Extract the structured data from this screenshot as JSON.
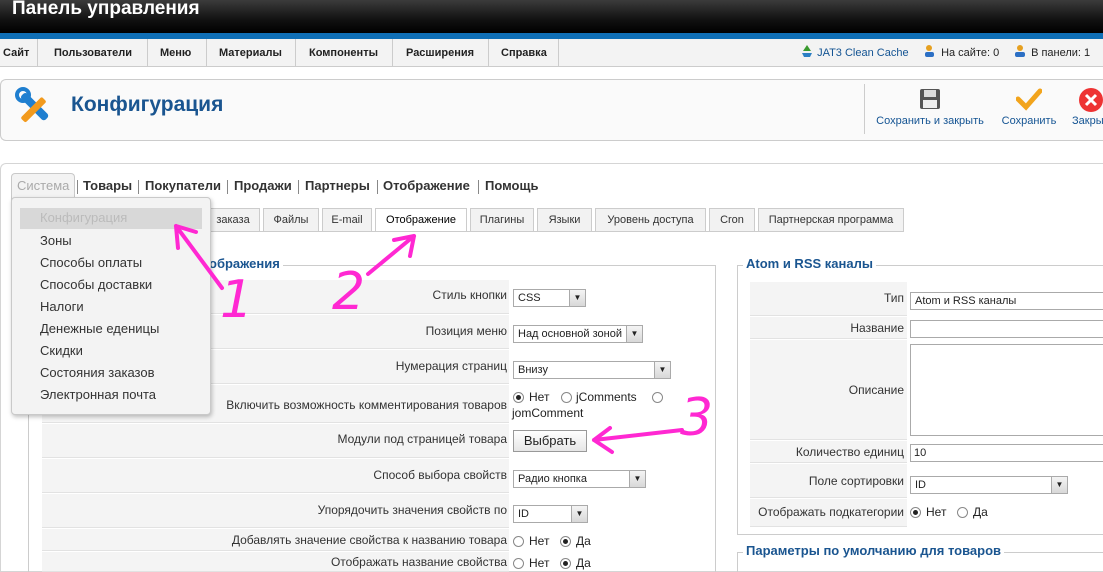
{
  "app_title": "Панель управления",
  "menubar": {
    "items": [
      "Сайт",
      "Пользователи",
      "Меню",
      "Материалы",
      "Компоненты",
      "Расширения",
      "Справка"
    ],
    "cache_label": "JAT3 Clean Cache",
    "online_label": "На сайте: 0",
    "admin_label": "В панели: 1"
  },
  "header": {
    "title": "Конфигурация",
    "toolbar": {
      "save_close_label": "Сохранить и закрыть",
      "save_label": "Сохранить",
      "close_label": "Закрыть"
    }
  },
  "primary_tabs": [
    "Система",
    "Товары",
    "Покупатели",
    "Продажи",
    "Партнеры",
    "Отображение",
    "Помощь"
  ],
  "dropdown": {
    "items": [
      "Конфигурация",
      "Зоны",
      "Способы оплаты",
      "Способы доставки",
      "Налоги",
      "Денежные еденицы",
      "Скидки",
      "Состояния заказов",
      "Электронная почта"
    ]
  },
  "sub_tabs": [
    "заказа",
    "Файлы",
    "E-mail",
    "Отображение",
    "Плагины",
    "Языки",
    "Уровень доступа",
    "Cron",
    "Партнерская программа"
  ],
  "display_section": {
    "legend": "ображения",
    "rows": {
      "button_style": {
        "label": "Стиль кнопки",
        "value": "CSS"
      },
      "menu_position": {
        "label": "Позиция меню",
        "value": "Над основной зоной"
      },
      "page_numbering": {
        "label": "Нумерация страниц",
        "value": "Внизу"
      },
      "comments": {
        "label": "Включить возможность комментирования товаров",
        "options": [
          "Нет",
          "jComments",
          "jomComment"
        ]
      },
      "modules": {
        "label": "Модули под страницей товара",
        "button": "Выбрать"
      },
      "property_select": {
        "label": "Способ выбора свойств",
        "value": "Радио кнопка"
      },
      "order_properties": {
        "label": "Упорядочить значения свойств по",
        "value": "ID"
      },
      "add_property_value": {
        "label": "Добавлять значение свойства к названию товара",
        "options": [
          "Нет",
          "Да"
        ]
      },
      "show_property_name": {
        "label": "Отображать название свойства",
        "options": [
          "Нет",
          "Да"
        ]
      }
    }
  },
  "rss_section": {
    "legend": "Atom и RSS каналы",
    "rows": {
      "type": {
        "label": "Тип",
        "value": "Atom и RSS каналы"
      },
      "name": {
        "label": "Название",
        "value": ""
      },
      "description": {
        "label": "Описание",
        "value": ""
      },
      "count": {
        "label": "Количество единиц",
        "value": "10"
      },
      "sort": {
        "label": "Поле сортировки",
        "value": "ID"
      },
      "subcats": {
        "label": "Отображать подкатегории",
        "options": [
          "Нет",
          "Да"
        ]
      }
    }
  },
  "defaults_section": {
    "legend": "Параметры по умолчанию для товаров"
  },
  "annotations": [
    "1",
    "2",
    "3"
  ],
  "colors": {
    "accent": "#1a5590",
    "annotation": "#ff28d2",
    "top_strip": "#0f6fb6"
  }
}
